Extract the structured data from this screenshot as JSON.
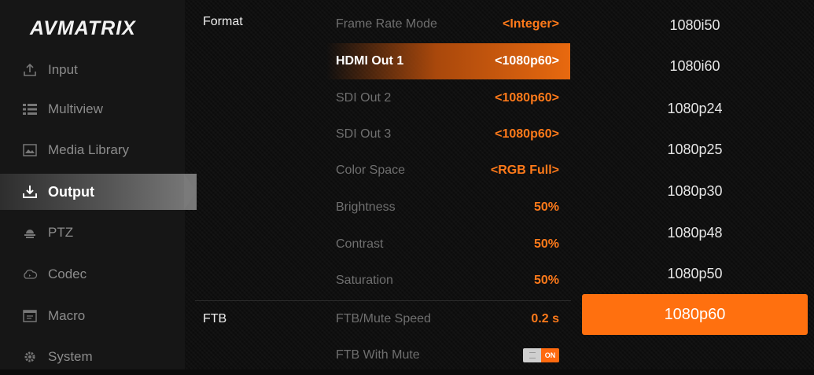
{
  "brand": {
    "logo_text": "AVMATRIX"
  },
  "sidebar": {
    "items": [
      {
        "label": "Input",
        "icon": "upload-icon"
      },
      {
        "label": "Multiview",
        "icon": "list-icon"
      },
      {
        "label": "Media Library",
        "icon": "image-icon"
      },
      {
        "label": "Output",
        "icon": "download-icon",
        "active": true
      },
      {
        "label": "PTZ",
        "icon": "ptz-camera-icon"
      },
      {
        "label": "Codec",
        "icon": "cloud-icon"
      },
      {
        "label": "Macro",
        "icon": "macro-icon"
      },
      {
        "label": "System",
        "icon": "gear-icon"
      }
    ]
  },
  "sections": {
    "format_label": "Format",
    "ftb_label": "FTB"
  },
  "settings": [
    {
      "name": "Frame Rate Mode",
      "value": "<Integer>"
    },
    {
      "name": "HDMI Out 1",
      "value": "<1080p60>",
      "selected": true
    },
    {
      "name": "SDI Out 2",
      "value": "<1080p60>"
    },
    {
      "name": "SDI Out 3",
      "value": "<1080p60>"
    },
    {
      "name": "Color Space",
      "value": "<RGB Full>"
    },
    {
      "name": "Brightness",
      "value": "50%"
    },
    {
      "name": "Contrast",
      "value": "50%"
    },
    {
      "name": "Saturation",
      "value": "50%"
    },
    {
      "name": "FTB/Mute Speed",
      "value": "0.2 s"
    },
    {
      "name": "FTB With Mute",
      "toggle_label": "ON",
      "toggle_on": true
    }
  ],
  "resolutions": [
    {
      "label": "1080i50"
    },
    {
      "label": "1080i60"
    },
    {
      "label": "1080p24"
    },
    {
      "label": "1080p25"
    },
    {
      "label": "1080p30"
    },
    {
      "label": "1080p48"
    },
    {
      "label": "1080p50"
    },
    {
      "label": "1080p60",
      "selected": true
    }
  ],
  "colors": {
    "accent": "#ff700f",
    "selected_gradient_end": "#e8690f",
    "muted_text": "#6f6f6f"
  }
}
